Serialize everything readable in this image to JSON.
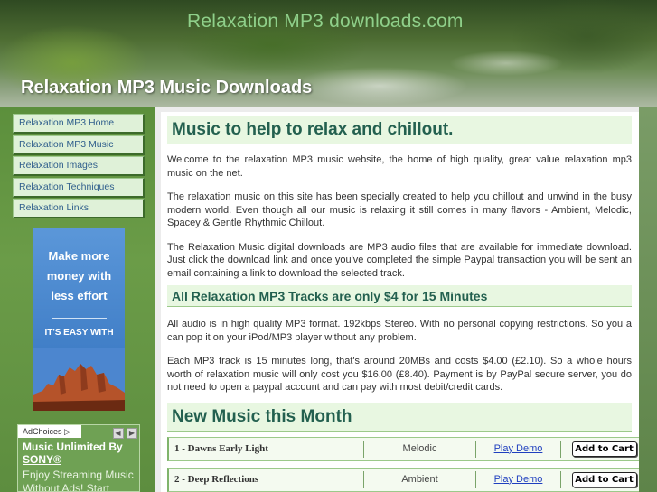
{
  "header": {
    "brand": "Relaxation MP3 downloads.com",
    "title": "Relaxation MP3 Music Downloads"
  },
  "nav": {
    "items": [
      {
        "label": "Relaxation MP3 Home"
      },
      {
        "label": "Relaxation MP3 Music"
      },
      {
        "label": "Relaxation Images"
      },
      {
        "label": "Relaxation Techniques"
      },
      {
        "label": "Relaxation Links"
      }
    ]
  },
  "ad_banner": {
    "line1": "Make more",
    "line2": "money with",
    "line3": "less effort",
    "line4": "IT'S EASY WITH"
  },
  "ad_box": {
    "adchoices": "AdChoices",
    "headline": "Music Unlimited By",
    "link": "SONY®",
    "desc1": "Enjoy Streaming Music",
    "desc2": "Without Ads! Start"
  },
  "main": {
    "heading": "Music to help to relax and chillout.",
    "para1": "Welcome to the relaxation MP3 music website, the home of high quality, great value relaxation mp3 music on the net.",
    "para2": "The relaxation music on this site has been specially created to help you chillout and unwind in the busy modern world. Even though all our music is relaxing it still comes in many flavors - Ambient, Melodic, Spacey & Gentle Rhythmic Chillout.",
    "para3": "The Relaxation Music digital downloads are MP3 audio files that are available for immediate download. Just click the download link and once you've completed the simple Paypal transaction you will be sent an email containing a link to download the selected track.",
    "subheading": "All Relaxation MP3 Tracks are only $4 for 15 Minutes",
    "para4": "All audio is in high quality MP3 format. 192kbps Stereo. With no personal copying restrictions. So you a can pop it on your iPod/MP3 player without any problem.",
    "para5": "Each MP3 track is 15 minutes long, that's around 20MBs and costs $4.00 (£2.10). So a whole hours worth of relaxation music will only cost you $16.00 (£8.40). Payment is by PayPal secure server, you do not need to open a paypal account and can pay with most debit/credit cards.",
    "new_heading": "New Music this Month"
  },
  "tracks": [
    {
      "name": "1 - Dawns Early Light",
      "genre": "Melodic",
      "demo": "Play Demo",
      "cart": "Add to Cart"
    },
    {
      "name": "2 - Deep Reflections",
      "genre": "Ambient",
      "demo": "Play Demo",
      "cart": "Add to Cart"
    }
  ]
}
